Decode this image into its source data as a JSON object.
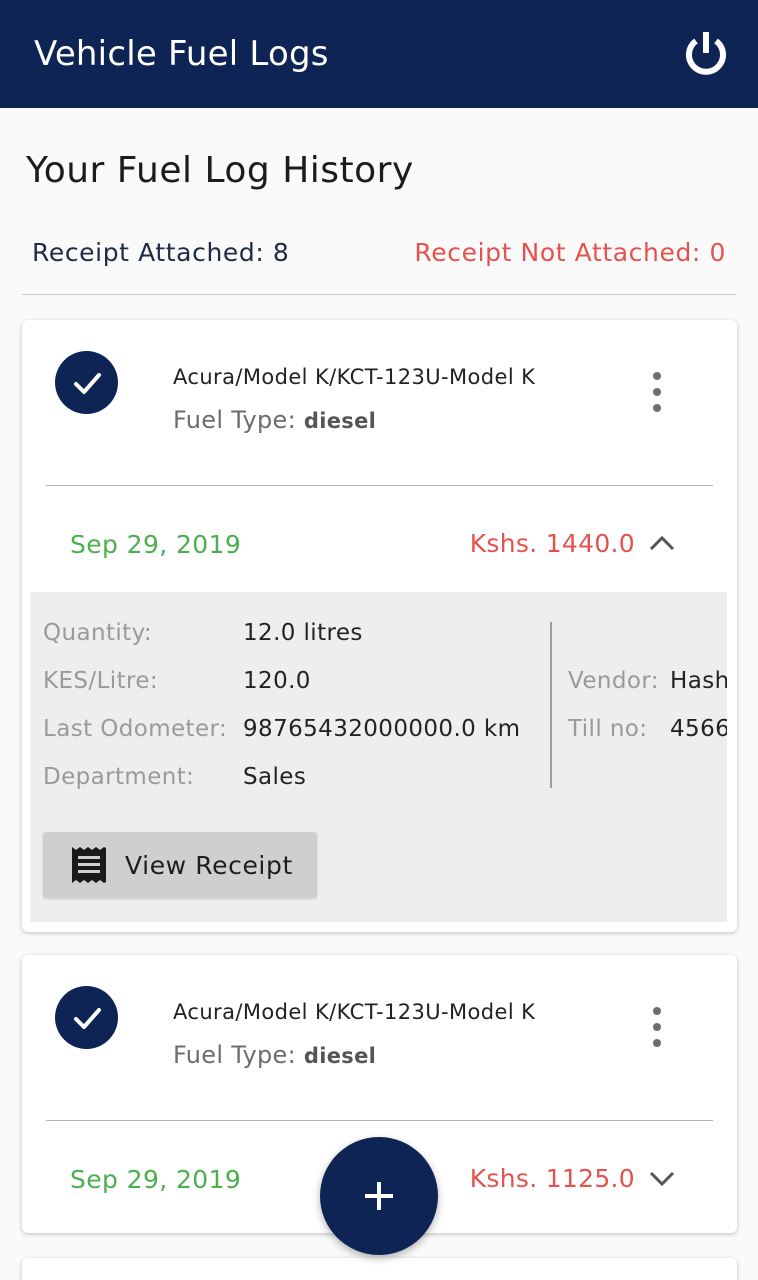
{
  "app_bar": {
    "title": "Vehicle Fuel Logs",
    "power_icon": "power-icon"
  },
  "page": {
    "title": "Your Fuel Log History",
    "receipt_attached": "Receipt Attached: 8",
    "receipt_not_attached": "Receipt Not Attached: 0"
  },
  "colors": {
    "primary": "#0e2454",
    "date_green": "#4caf50",
    "amount_red": "#e5524d"
  },
  "logs": [
    {
      "vehicle": "Acura/Model K/KCT-123U-Model K",
      "fuel_type_label": "Fuel Type:",
      "fuel_type_value": "diesel",
      "date": "Sep 29, 2019",
      "amount": "Kshs. 1440.0",
      "expanded": true,
      "details": {
        "quantity_label": "Quantity:",
        "quantity_value": "12.0 litres",
        "price_label": "KES/Litre:",
        "price_value": "120.0",
        "odometer_label": "Last Odometer:",
        "odometer_value": "98765432000000.0 km",
        "department_label": "Department:",
        "department_value": "Sales",
        "vendor_label": "Vendor:",
        "vendor_value": "Hash",
        "till_label": "Till no:",
        "till_value": "4566"
      },
      "view_receipt_label": "View Receipt"
    },
    {
      "vehicle": "Acura/Model K/KCT-123U-Model K",
      "fuel_type_label": "Fuel Type:",
      "fuel_type_value": "diesel",
      "date": "Sep 29, 2019",
      "amount": "Kshs. 1125.0",
      "expanded": false
    }
  ],
  "fab": {
    "icon": "plus-icon"
  }
}
